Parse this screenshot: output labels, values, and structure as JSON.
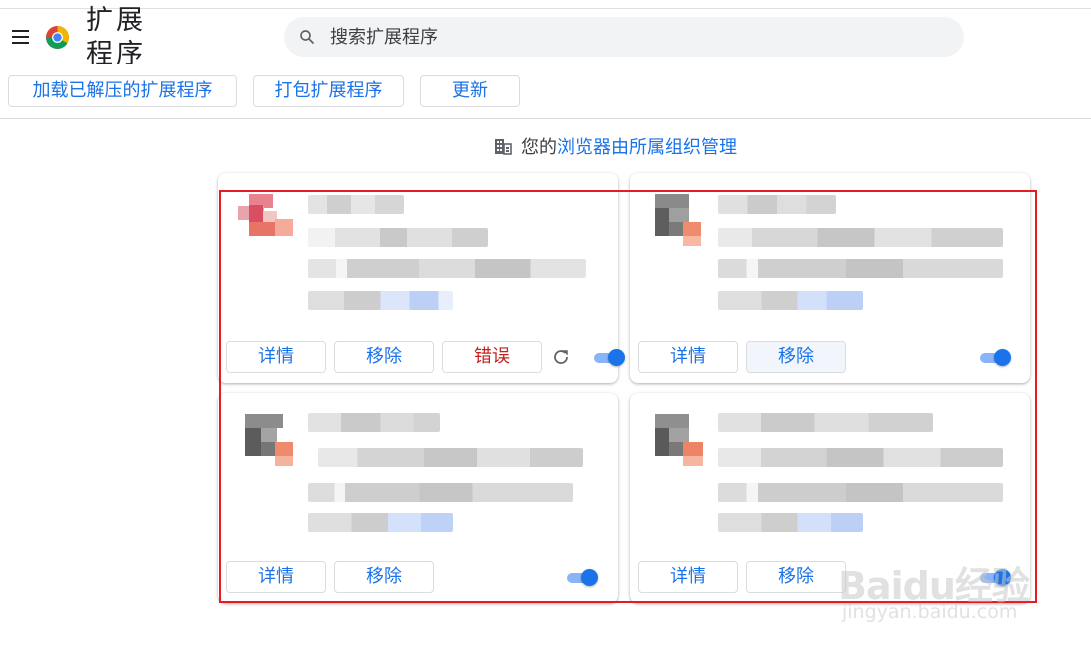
{
  "header": {
    "page_title": "扩展程序",
    "search_placeholder": "搜索扩展程序"
  },
  "toolbar": {
    "load_unpacked": "加载已解压的扩展程序",
    "pack_extension": "打包扩展程序",
    "update": "更新"
  },
  "managed_notice": {
    "prefix": "您的",
    "link": "浏览器由所属组织管理"
  },
  "cards": [
    {
      "details": "详情",
      "remove": "移除",
      "errors": "错误",
      "enabled": true
    },
    {
      "details": "详情",
      "remove": "移除",
      "enabled": true
    },
    {
      "details": "详情",
      "remove": "移除",
      "enabled": true
    },
    {
      "details": "详情",
      "remove": "移除",
      "enabled": true
    }
  ],
  "watermark": {
    "brand": "Baidu经验",
    "url": "jingyan.baidu.com"
  },
  "colors": {
    "accent": "#1a73e8",
    "error_text": "#c5221f",
    "highlight_frame": "#e51c23"
  },
  "icons": [
    "menu-icon",
    "chrome-logo-icon",
    "search-icon",
    "building-icon",
    "reload-icon"
  ]
}
